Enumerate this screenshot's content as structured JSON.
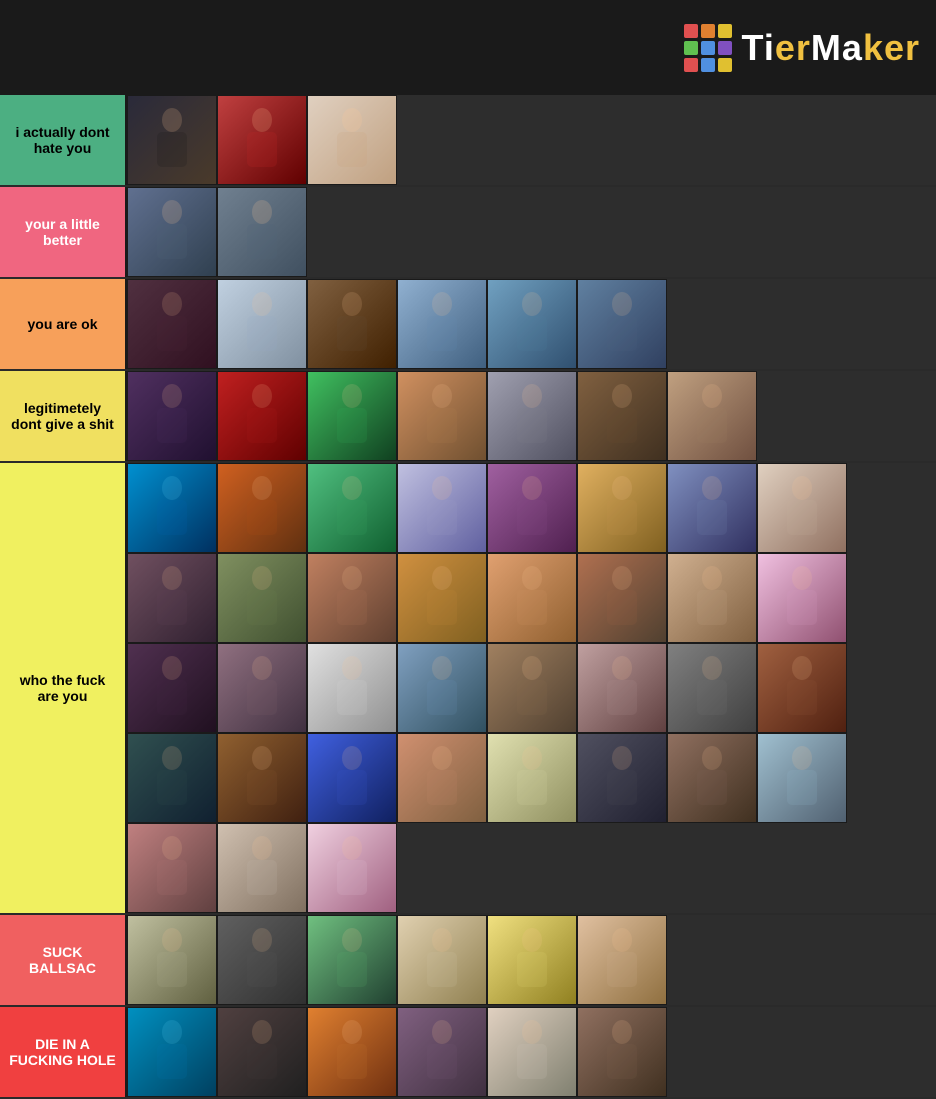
{
  "app": {
    "name": "TierMaker",
    "logo_text": "TierMaker"
  },
  "logo_dots": [
    {
      "color": "#e05050"
    },
    {
      "color": "#e08030"
    },
    {
      "color": "#e0c030"
    },
    {
      "color": "#60c050"
    },
    {
      "color": "#5090e0"
    },
    {
      "color": "#8050c0"
    },
    {
      "color": "#e05050"
    },
    {
      "color": "#5090e0"
    },
    {
      "color": "#e0c030"
    }
  ],
  "tiers": [
    {
      "id": "s",
      "label": "i actually dont hate you",
      "color": "#4caf82",
      "text_color": "#000",
      "image_count": 3,
      "gradients": [
        "grad1",
        "grad1",
        "grad1"
      ]
    },
    {
      "id": "a",
      "label": "your a little better",
      "color": "#f06680",
      "text_color": "#fff",
      "image_count": 2,
      "gradients": [
        "grad2",
        "grad2"
      ]
    },
    {
      "id": "b",
      "label": "you are ok",
      "color": "#f7a05a",
      "text_color": "#000",
      "image_count": 6,
      "gradients": [
        "grad3",
        "grad3",
        "grad3",
        "grad3",
        "grad3",
        "grad3"
      ]
    },
    {
      "id": "c",
      "label": "legitimetely dont give a shit",
      "color": "#f0e060",
      "text_color": "#000",
      "image_count": 7,
      "gradients": [
        "grad4",
        "grad4",
        "grad4",
        "grad4",
        "grad4",
        "grad4",
        "grad4"
      ]
    },
    {
      "id": "d",
      "label": "who the fuck are you",
      "color": "#f0f060",
      "text_color": "#000",
      "image_count": 35,
      "gradients": [
        "grad5",
        "grad6",
        "grad7",
        "grad8",
        "grad9",
        "grad5",
        "grad6",
        "grad7",
        "grad8",
        "grad9",
        "grad5",
        "grad6",
        "grad7",
        "grad8",
        "grad9",
        "grad5",
        "grad6",
        "grad7",
        "grad8",
        "grad9",
        "grad5",
        "grad6",
        "grad7",
        "grad8",
        "grad9",
        "grad5",
        "grad6",
        "grad7",
        "grad8",
        "grad5",
        "grad6",
        "grad7",
        "grad8",
        "grad9",
        "grad5"
      ]
    },
    {
      "id": "f",
      "label": "SUCK BALLSAC",
      "color": "#f06060",
      "text_color": "#fff",
      "image_count": 6,
      "gradients": [
        "grad1",
        "grad2",
        "grad3",
        "grad4",
        "grad5",
        "grad6"
      ]
    },
    {
      "id": "g",
      "label": "DIE IN A FUCKING HOLE",
      "color": "#f04040",
      "text_color": "#fff",
      "image_count": 6,
      "gradients": [
        "grad5",
        "grad2",
        "grad9",
        "grad3",
        "grad6",
        "grad4"
      ]
    }
  ]
}
